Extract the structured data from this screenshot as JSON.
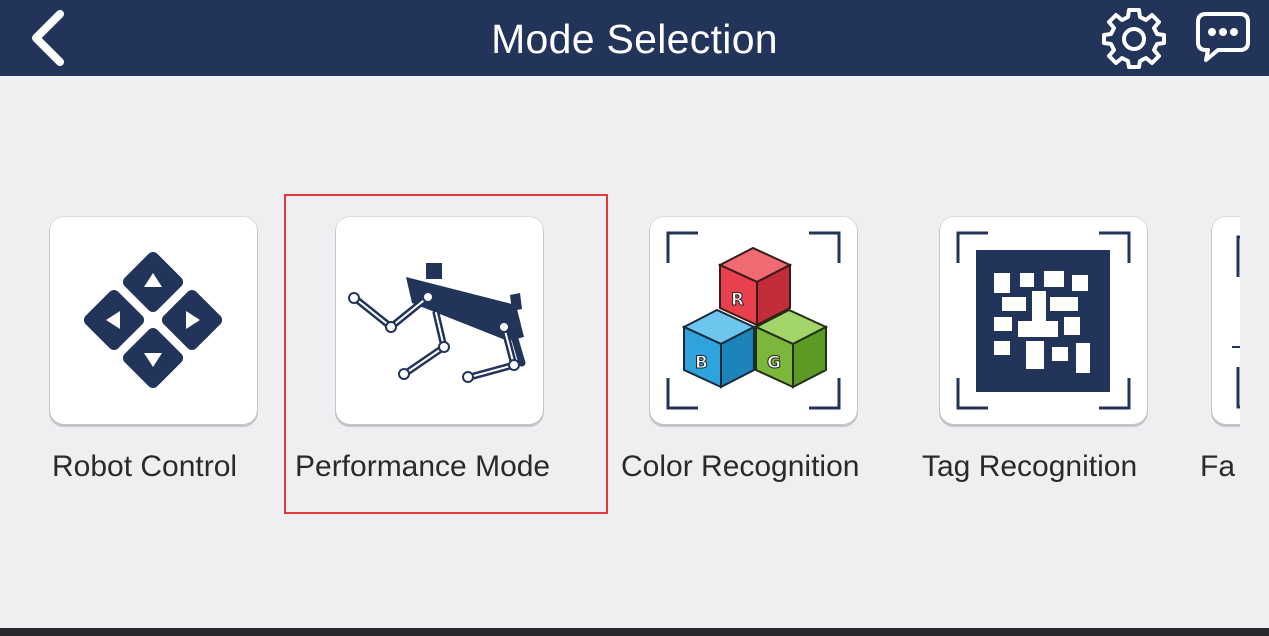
{
  "header": {
    "title": "Mode Selection",
    "back_icon": "chevron-left-icon",
    "settings_icon": "gear-icon",
    "chat_icon": "chat-bubble-icon",
    "background_color": "#22345a"
  },
  "modes": [
    {
      "label": "Robot Control",
      "icon": "direction-pad-icon"
    },
    {
      "label": "Performance Mode",
      "icon": "robot-dog-icon",
      "selected": true
    },
    {
      "label": "Color Recognition",
      "icon": "rgb-cubes-icon"
    },
    {
      "label": "Tag Recognition",
      "icon": "apriltag-icon"
    },
    {
      "label": "Fa",
      "icon": "face-frame-icon"
    }
  ],
  "colors": {
    "accent_navy": "#22345a",
    "selection_border": "#e03a3a",
    "cube_red": "#e8414d",
    "cube_blue": "#2ea3dc",
    "cube_green": "#7ab73a"
  }
}
